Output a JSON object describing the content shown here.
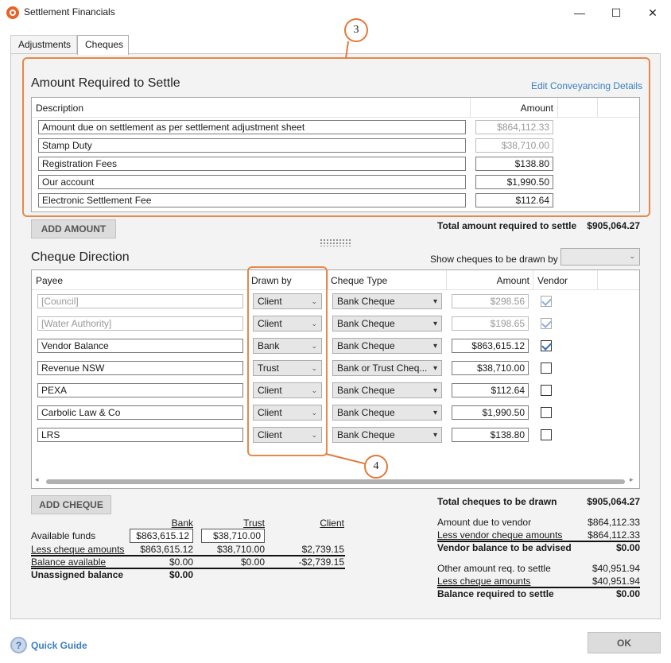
{
  "window": {
    "title": "Settlement Financials",
    "controls": {
      "minimize": "—",
      "maximize": "☐",
      "close": "✕"
    }
  },
  "tabs": [
    {
      "label": "Adjustments"
    },
    {
      "label": "Cheques"
    }
  ],
  "callouts": {
    "one": "3",
    "two": "4"
  },
  "settle": {
    "title": "Amount Required to Settle",
    "edit_link": "Edit Conveyancing Details",
    "headers": {
      "description": "Description",
      "amount": "Amount"
    },
    "rows": [
      {
        "description": "Amount due on settlement as per settlement adjustment sheet",
        "amount": "$864,112.33"
      },
      {
        "description": "Stamp Duty",
        "amount": "$38,710.00"
      },
      {
        "description": "Registration Fees",
        "amount": "$138.80"
      },
      {
        "description": "Our account",
        "amount": "$1,990.50"
      },
      {
        "description": "Electronic Settlement Fee",
        "amount": "$112.64"
      }
    ],
    "add_button": "ADD AMOUNT",
    "total_label": "Total amount required to settle",
    "total_value": "$905,064.27"
  },
  "cheques": {
    "title": "Cheque Direction",
    "show_label": "Show cheques to be drawn by",
    "show_value": "",
    "headers": {
      "payee": "Payee",
      "drawn_by": "Drawn by",
      "cheque_type": "Cheque Type",
      "amount": "Amount",
      "vendor": "Vendor"
    },
    "rows": [
      {
        "payee": "[Council]",
        "drawn_by": "Client",
        "cheque_type": "Bank Cheque",
        "amount": "$298.56",
        "vendor": true
      },
      {
        "payee": "[Water Authority]",
        "drawn_by": "Client",
        "cheque_type": "Bank Cheque",
        "amount": "$198.65",
        "vendor": true
      },
      {
        "payee": "Vendor Balance",
        "drawn_by": "Bank",
        "cheque_type": "Bank Cheque",
        "amount": "$863,615.12",
        "vendor": true
      },
      {
        "payee": "Revenue NSW",
        "drawn_by": "Trust",
        "cheque_type": "Bank or Trust Cheq...",
        "amount": "$38,710.00",
        "vendor": false
      },
      {
        "payee": "PEXA",
        "drawn_by": "Client",
        "cheque_type": "Bank Cheque",
        "amount": "$112.64",
        "vendor": false
      },
      {
        "payee": "Carbolic Law & Co",
        "drawn_by": "Client",
        "cheque_type": "Bank Cheque",
        "amount": "$1,990.50",
        "vendor": false
      },
      {
        "payee": "LRS",
        "drawn_by": "Client",
        "cheque_type": "Bank Cheque",
        "amount": "$138.80",
        "vendor": false
      }
    ],
    "add_button": "ADD CHEQUE"
  },
  "funds": {
    "headers": {
      "bank": "Bank",
      "trust": "Trust",
      "client": "Client"
    },
    "available_label": "Available funds",
    "available_bank": "$863,615.12",
    "available_trust": "$38,710.00",
    "less_label": "Less cheque amounts",
    "less_bank": "$863,615.12",
    "less_trust": "$38,710.00",
    "less_client": "$2,739.15",
    "balance_label": "Balance available",
    "balance_bank": "$0.00",
    "balance_trust": "$0.00",
    "balance_client": "-$2,739.15",
    "unassigned_label": "Unassigned balance",
    "unassigned_value": "$0.00"
  },
  "summary": {
    "total_cheques_label": "Total cheques to be drawn",
    "total_cheques_value": "$905,064.27",
    "due_vendor_label": "Amount due to vendor",
    "due_vendor_value": "$864,112.33",
    "less_vendor_label": "Less vendor cheque amounts",
    "less_vendor_value": "$864,112.33",
    "vendor_balance_label": "Vendor balance to be advised",
    "vendor_balance_value": "$0.00",
    "other_label": "Other amount req. to settle",
    "other_value": "$40,951.94",
    "less_cheque_label": "Less cheque amounts",
    "less_cheque_value": "$40,951.94",
    "balance_label": "Balance required to settle",
    "balance_value": "$0.00"
  },
  "footer": {
    "quick_guide": "Quick Guide",
    "ok": "OK"
  }
}
